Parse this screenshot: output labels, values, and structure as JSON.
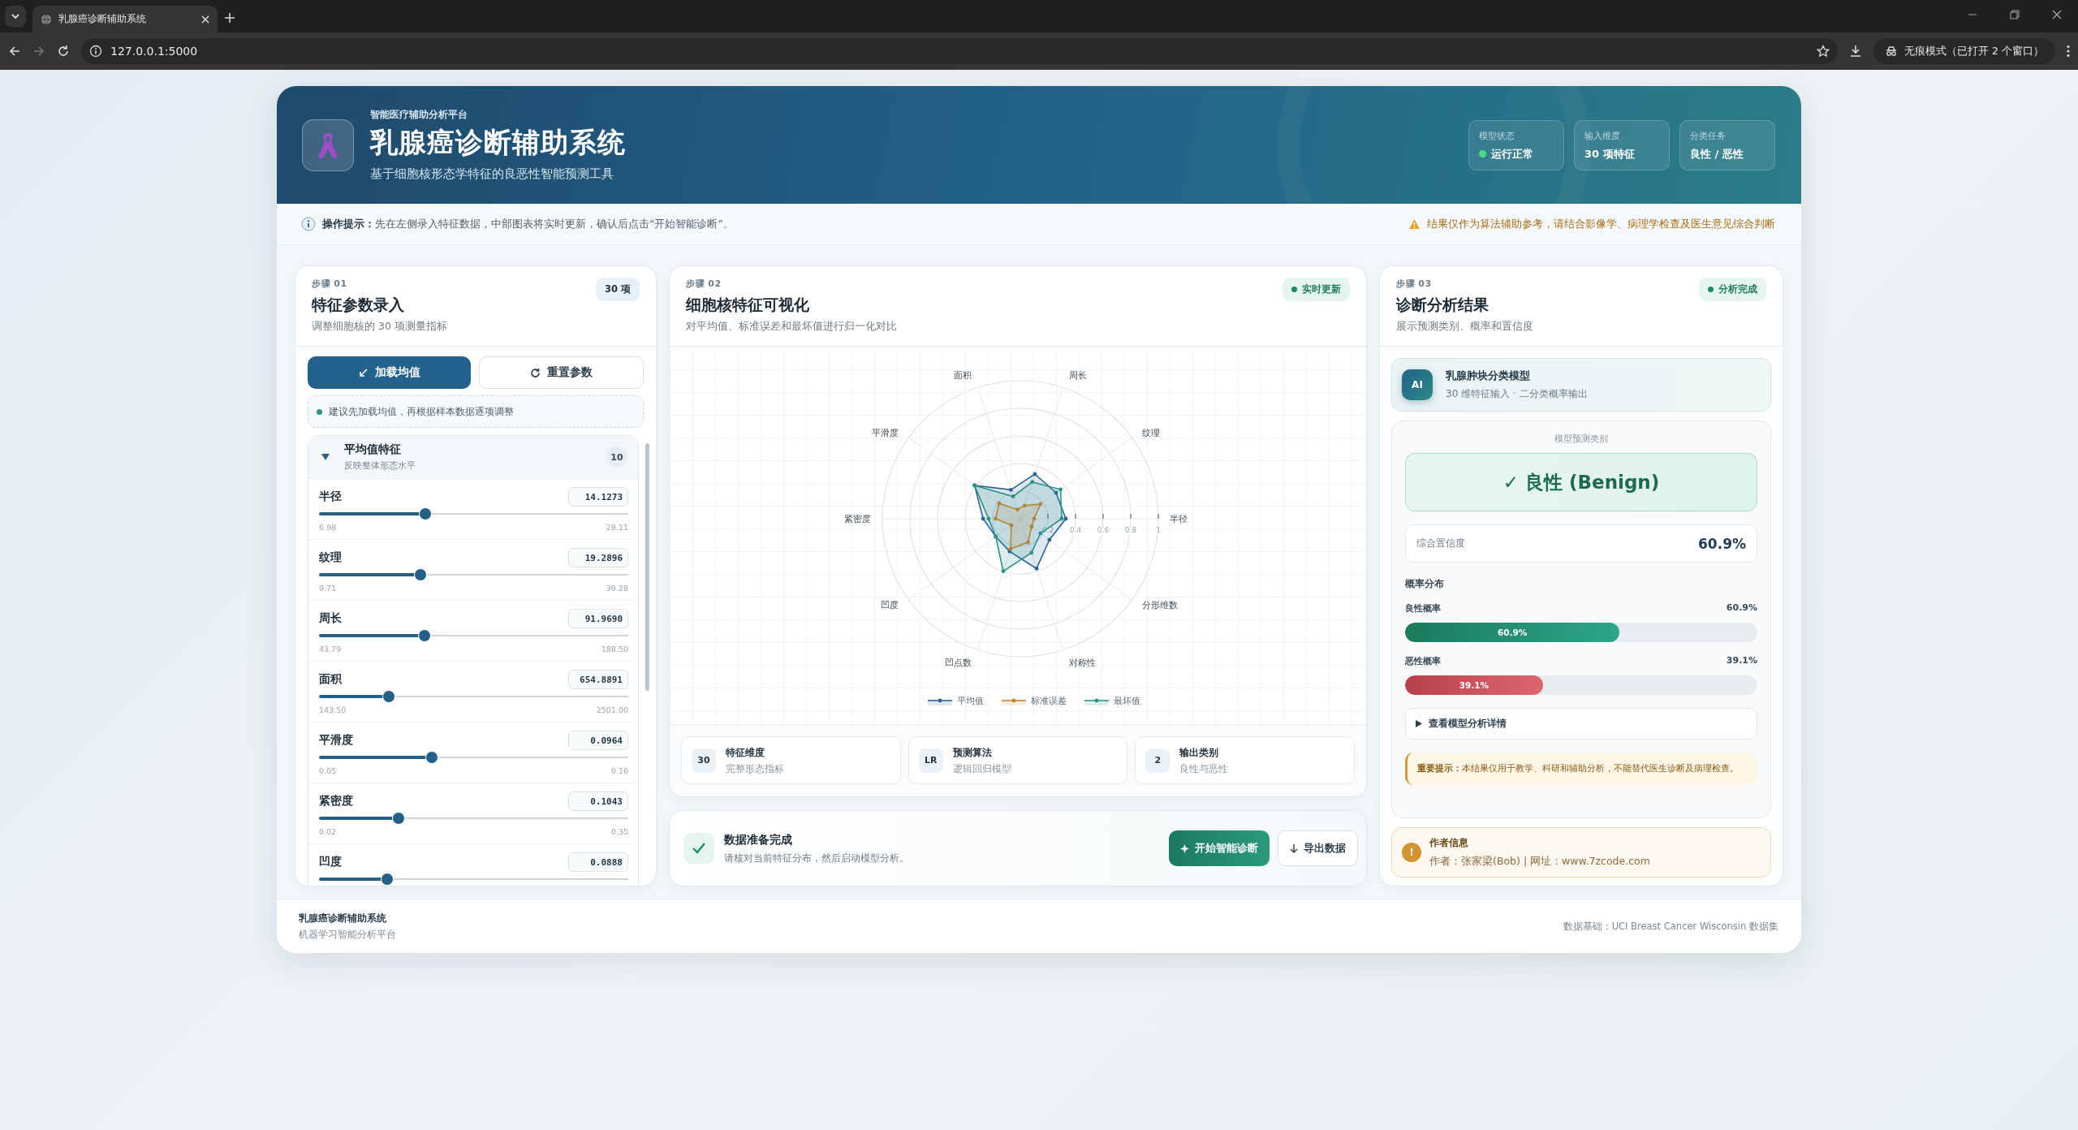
{
  "browser": {
    "tab_title": "乳腺癌诊断辅助系统",
    "url": "127.0.0.1:5000",
    "profile": "无痕模式（已打开 2 个窗口）"
  },
  "header": {
    "tagline": "智能医疗辅助分析平台",
    "title": "乳腺癌诊断辅助系统",
    "subtitle": "基于细胞核形态学特征的良恶性智能预测工具",
    "stats": [
      {
        "label": "模型状态",
        "value": "运行正常",
        "kind": "status"
      },
      {
        "label": "输入维度",
        "value": "30 项特征",
        "kind": "plain"
      },
      {
        "label": "分类任务",
        "value": "良性 / 恶性",
        "kind": "plain"
      }
    ]
  },
  "notice": {
    "text": "**操作提示：**先在左侧录入特征数据，中部图表将实时更新，确认后点击“开始智能诊断”。",
    "warning": "结果仅作为算法辅助参考，请结合影像学、病理学检查及医生意见综合判断"
  },
  "input_panel": {
    "step": "步骤 01",
    "title": "特征参数录入",
    "subtitle": "调整细胞核的 30 项测量指标",
    "badge": "30 项",
    "buttons": [
      {
        "label": "加载均值",
        "kind": "primary"
      },
      {
        "label": "重置参数",
        "kind": "secondary"
      }
    ],
    "tip": "建议先加载均值，再根据样本数据逐项调整",
    "groups": [
      {
        "title": "平均值特征",
        "subtitle": "反映整体形态水平",
        "count": "10",
        "expanded": true,
        "features": [
          {
            "name": "半径",
            "value": "14.1273",
            "min": "6.98",
            "max": "28.11",
            "level": 0.345
          },
          {
            "name": "纹理",
            "value": "19.2896",
            "min": "9.71",
            "max": "39.28",
            "level": 0.328
          },
          {
            "name": "周长",
            "value": "91.9690",
            "min": "43.79",
            "max": "188.50",
            "level": 0.34
          },
          {
            "name": "面积",
            "value": "654.8891",
            "min": "143.50",
            "max": "2501.00",
            "level": 0.227
          },
          {
            "name": "平滑度",
            "value": "0.0964",
            "min": "0.05",
            "max": "0.16",
            "level": 0.366
          },
          {
            "name": "紧密度",
            "value": "0.1043",
            "min": "0.02",
            "max": "0.35",
            "level": 0.256
          },
          {
            "name": "凹度",
            "value": "0.0888",
            "level": 0.221
          }
        ]
      }
    ]
  },
  "chart_panel": {
    "step": "步骤 02",
    "title": "细胞核特征可视化",
    "subtitle": "对平均值、标准误差和最坏值进行归一化对比",
    "badge": "实时更新",
    "chart_data": {
      "type": "radar",
      "categories": [
        "周长",
        "纹理",
        "半径",
        "分形维数",
        "对称性",
        "凹点数",
        "凹度",
        "紧密度",
        "平滑度",
        "面积"
      ],
      "ylim": [
        0,
        1
      ],
      "yticks": [
        0.2,
        0.4,
        0.6,
        0.8,
        1
      ],
      "legend": "bottom",
      "series": [
        {
          "name": "平均值",
          "color": "#2a6496",
          "values": [
            0.34,
            0.32,
            0.33,
            0.26,
            0.38,
            0.25,
            0.22,
            0.27,
            0.41,
            0.22
          ]
        },
        {
          "name": "标准误差",
          "color": "#c8822e",
          "values": [
            0.1,
            0.18,
            0.1,
            0.1,
            0.18,
            0.23,
            0.08,
            0.18,
            0.19,
            0.07
          ]
        },
        {
          "name": "最坏值",
          "color": "#2a9287",
          "values": [
            0.28,
            0.36,
            0.3,
            0.18,
            0.26,
            0.4,
            0.22,
            0.23,
            0.41,
            0.17
          ]
        }
      ]
    },
    "stats": [
      {
        "value": "30",
        "label": "特征维度",
        "sub": "完整形态指标"
      },
      {
        "value": "LR",
        "label": "预测算法",
        "sub": "逻辑回归模型"
      },
      {
        "value": "2",
        "label": "输出类别",
        "sub": "良性与恶性"
      }
    ]
  },
  "action": {
    "title": "数据准备完成",
    "text": "请核对当前特征分布，然后启动模型分析。",
    "buttons": [
      {
        "label": "开始智能诊断",
        "kind": "primary"
      },
      {
        "label": "导出数据",
        "kind": "secondary"
      }
    ]
  },
  "result_panel": {
    "step": "步骤 03",
    "title": "诊断分析结果",
    "subtitle": "展示预测类别、概率和置信度",
    "badge": "分析完成",
    "model": {
      "avatar": "AI",
      "name": "乳腺肿块分类模型",
      "description": "30 维特征输入 · 二分类概率输出"
    },
    "prediction_label": "模型预测类别",
    "prediction": "✓ 良性 (Benign)",
    "confidence_label": "综合置信度",
    "confidence": "60.9%",
    "distribution_title": "概率分布",
    "probabilities": [
      {
        "label": "良性概率",
        "value": "60.9%",
        "bar_label": "60.9%",
        "level": 0.609,
        "kind": "benign"
      },
      {
        "label": "恶性概率",
        "value": "39.1%",
        "bar_label": "39.1%",
        "level": 0.391,
        "kind": "malignant"
      }
    ],
    "details": {
      "label": "查看模型分析详情",
      "expanded": false
    },
    "warning": "**重要提示：**本结果仅用于教学、科研和辅助分析，不能替代医生诊断及病理检查。"
  },
  "author": {
    "icon": "!",
    "title": "作者信息",
    "text": "作者：张家梁(Bob) | 网址：www.7zcode.com"
  },
  "footer": {
    "title": "乳腺癌诊断辅助系统",
    "subtitle": "机器学习智能分析平台",
    "source": "数据基础：UCI Breast Cancer Wisconsin 数据集"
  }
}
